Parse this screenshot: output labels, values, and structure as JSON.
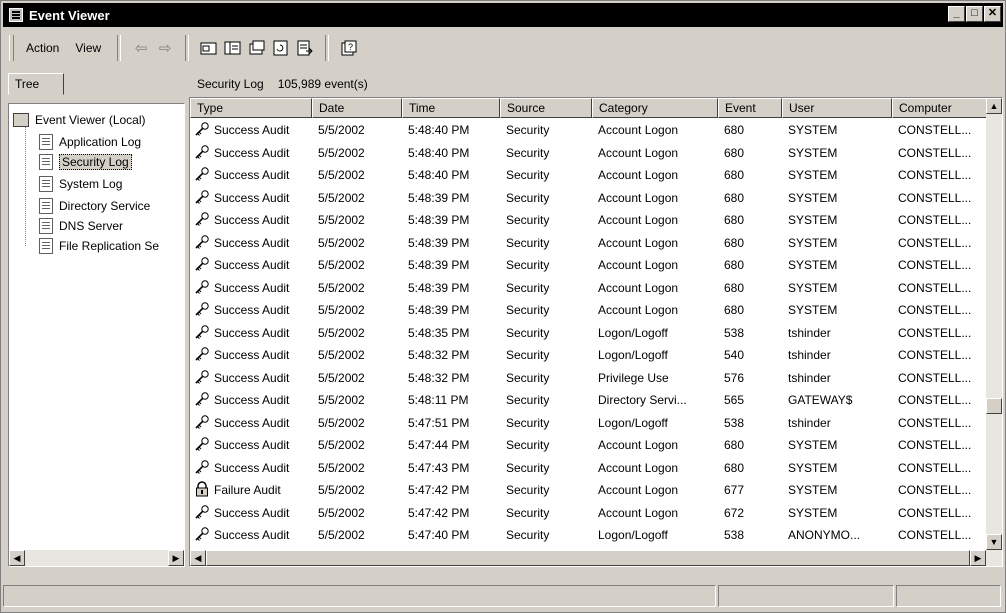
{
  "window": {
    "title": "Event Viewer"
  },
  "menu": {
    "action": "Action",
    "view": "View"
  },
  "tree": {
    "tab_label": "Tree",
    "root": "Event Viewer (Local)",
    "items": [
      "Application Log",
      "Security Log",
      "System Log",
      "Directory Service",
      "DNS Server",
      "File Replication Se"
    ],
    "selected_index": 1
  },
  "log": {
    "name": "Security Log",
    "count": "105,989 event(s)"
  },
  "columns": [
    "Type",
    "Date",
    "Time",
    "Source",
    "Category",
    "Event",
    "User",
    "Computer"
  ],
  "rows": [
    {
      "type": "Success Audit",
      "date": "5/5/2002",
      "time": "5:48:40 PM",
      "source": "Security",
      "category": "Account Logon",
      "event": "680",
      "user": "SYSTEM",
      "computer": "CONSTELL..."
    },
    {
      "type": "Success Audit",
      "date": "5/5/2002",
      "time": "5:48:40 PM",
      "source": "Security",
      "category": "Account Logon",
      "event": "680",
      "user": "SYSTEM",
      "computer": "CONSTELL..."
    },
    {
      "type": "Success Audit",
      "date": "5/5/2002",
      "time": "5:48:40 PM",
      "source": "Security",
      "category": "Account Logon",
      "event": "680",
      "user": "SYSTEM",
      "computer": "CONSTELL..."
    },
    {
      "type": "Success Audit",
      "date": "5/5/2002",
      "time": "5:48:39 PM",
      "source": "Security",
      "category": "Account Logon",
      "event": "680",
      "user": "SYSTEM",
      "computer": "CONSTELL..."
    },
    {
      "type": "Success Audit",
      "date": "5/5/2002",
      "time": "5:48:39 PM",
      "source": "Security",
      "category": "Account Logon",
      "event": "680",
      "user": "SYSTEM",
      "computer": "CONSTELL..."
    },
    {
      "type": "Success Audit",
      "date": "5/5/2002",
      "time": "5:48:39 PM",
      "source": "Security",
      "category": "Account Logon",
      "event": "680",
      "user": "SYSTEM",
      "computer": "CONSTELL..."
    },
    {
      "type": "Success Audit",
      "date": "5/5/2002",
      "time": "5:48:39 PM",
      "source": "Security",
      "category": "Account Logon",
      "event": "680",
      "user": "SYSTEM",
      "computer": "CONSTELL..."
    },
    {
      "type": "Success Audit",
      "date": "5/5/2002",
      "time": "5:48:39 PM",
      "source": "Security",
      "category": "Account Logon",
      "event": "680",
      "user": "SYSTEM",
      "computer": "CONSTELL..."
    },
    {
      "type": "Success Audit",
      "date": "5/5/2002",
      "time": "5:48:39 PM",
      "source": "Security",
      "category": "Account Logon",
      "event": "680",
      "user": "SYSTEM",
      "computer": "CONSTELL..."
    },
    {
      "type": "Success Audit",
      "date": "5/5/2002",
      "time": "5:48:35 PM",
      "source": "Security",
      "category": "Logon/Logoff",
      "event": "538",
      "user": "tshinder",
      "computer": "CONSTELL..."
    },
    {
      "type": "Success Audit",
      "date": "5/5/2002",
      "time": "5:48:32 PM",
      "source": "Security",
      "category": "Logon/Logoff",
      "event": "540",
      "user": "tshinder",
      "computer": "CONSTELL..."
    },
    {
      "type": "Success Audit",
      "date": "5/5/2002",
      "time": "5:48:32 PM",
      "source": "Security",
      "category": "Privilege Use",
      "event": "576",
      "user": "tshinder",
      "computer": "CONSTELL..."
    },
    {
      "type": "Success Audit",
      "date": "5/5/2002",
      "time": "5:48:11 PM",
      "source": "Security",
      "category": "Directory Servi...",
      "event": "565",
      "user": "GATEWAY$",
      "computer": "CONSTELL..."
    },
    {
      "type": "Success Audit",
      "date": "5/5/2002",
      "time": "5:47:51 PM",
      "source": "Security",
      "category": "Logon/Logoff",
      "event": "538",
      "user": "tshinder",
      "computer": "CONSTELL..."
    },
    {
      "type": "Success Audit",
      "date": "5/5/2002",
      "time": "5:47:44 PM",
      "source": "Security",
      "category": "Account Logon",
      "event": "680",
      "user": "SYSTEM",
      "computer": "CONSTELL..."
    },
    {
      "type": "Success Audit",
      "date": "5/5/2002",
      "time": "5:47:43 PM",
      "source": "Security",
      "category": "Account Logon",
      "event": "680",
      "user": "SYSTEM",
      "computer": "CONSTELL..."
    },
    {
      "type": "Failure Audit",
      "date": "5/5/2002",
      "time": "5:47:42 PM",
      "source": "Security",
      "category": "Account Logon",
      "event": "677",
      "user": "SYSTEM",
      "computer": "CONSTELL..."
    },
    {
      "type": "Success Audit",
      "date": "5/5/2002",
      "time": "5:47:42 PM",
      "source": "Security",
      "category": "Account Logon",
      "event": "672",
      "user": "SYSTEM",
      "computer": "CONSTELL..."
    },
    {
      "type": "Success Audit",
      "date": "5/5/2002",
      "time": "5:47:40 PM",
      "source": "Security",
      "category": "Logon/Logoff",
      "event": "538",
      "user": "ANONYMO...",
      "computer": "CONSTELL..."
    }
  ],
  "icons": {
    "success": "key-icon",
    "failure": "lock-icon",
    "toolbar": [
      "back-arrow-icon",
      "forward-arrow-icon",
      "up-folder-icon",
      "show-hide-tree-icon",
      "properties-icon",
      "refresh-icon",
      "export-list-icon",
      "help-icon"
    ]
  }
}
